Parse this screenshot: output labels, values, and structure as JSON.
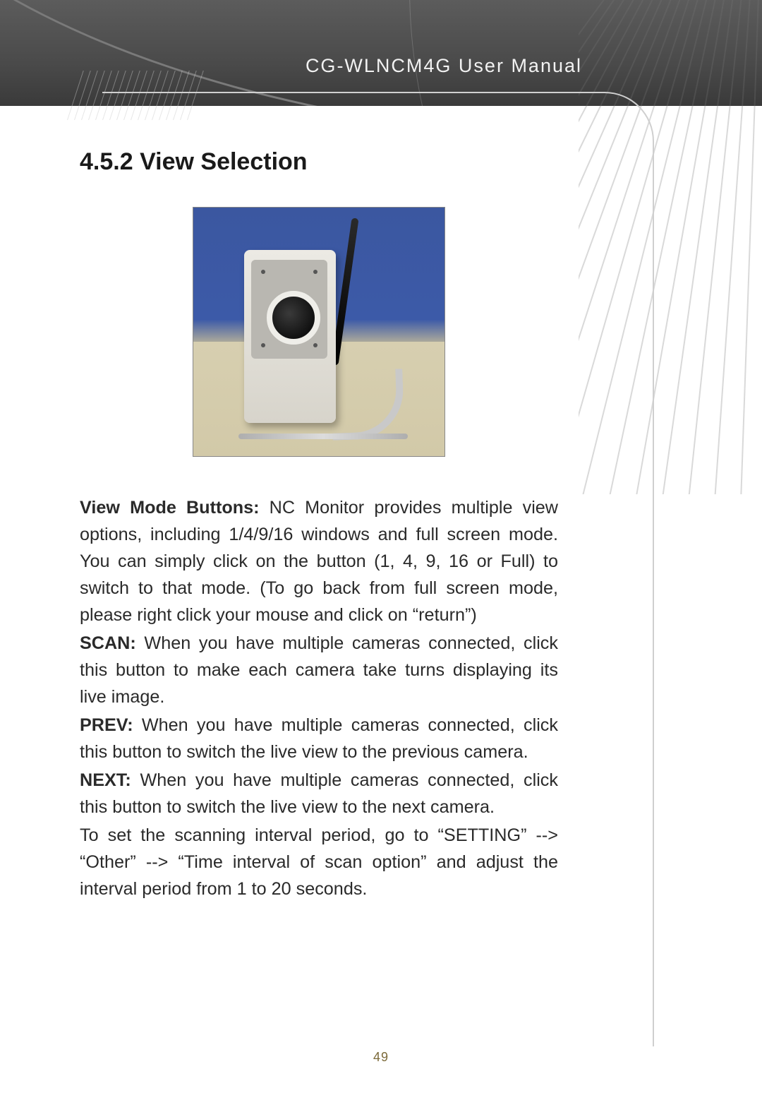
{
  "header": {
    "title": "CG-WLNCM4G User Manual"
  },
  "section": {
    "number": "4.5.2",
    "title": "View Selection"
  },
  "image": {
    "alt": "wireless network camera product photo"
  },
  "paragraphs": {
    "view_mode_label": "View Mode Buttons:",
    "view_mode_body": " NC Monitor provides multiple view options, including 1/4/9/16 windows and full screen mode. You can simply click on the button (1, 4, 9, 16 or Full) to switch to that mode. (To go back from full screen mode, please right click your mouse and click on “return”)",
    "scan_label": "SCAN:",
    "scan_body": " When you have multiple cameras connected, click this button to make each camera take turns displaying its live image.",
    "prev_label": "PREV:",
    "prev_body": " When you have multiple cameras connected, click this button to switch the live view to the previous camera.",
    "next_label": "NEXT:",
    "next_body": " When you have multiple cameras connected, click this button to switch the live view to the next camera.",
    "interval_body": "To set the scanning interval period, go to “SETTING” --> “Other” --> “Time interval of scan option” and adjust the interval period from 1 to 20 seconds."
  },
  "page_number": "49"
}
